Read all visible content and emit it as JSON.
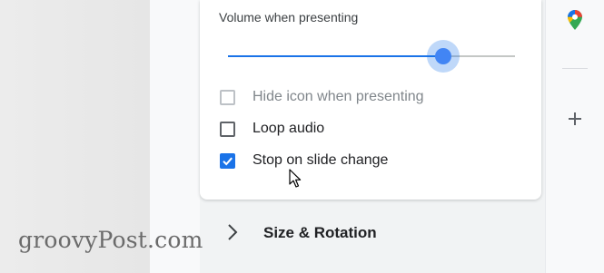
{
  "watermark": "groovyPost.com",
  "audio_options": {
    "volume_label": "Volume when presenting",
    "volume_level": 0.75,
    "options": [
      {
        "label": "Hide icon when presenting",
        "checked": false,
        "disabled": true
      },
      {
        "label": "Loop audio",
        "checked": false,
        "disabled": false
      },
      {
        "label": "Stop on slide change",
        "checked": true,
        "disabled": false
      }
    ]
  },
  "sections": {
    "size_rotation": "Size & Rotation"
  },
  "side_panel": {
    "icons": [
      "google-maps-icon",
      "plus-icon"
    ]
  },
  "colors": {
    "accent": "#1a73e8",
    "slider_thumb": "#4285f4"
  }
}
